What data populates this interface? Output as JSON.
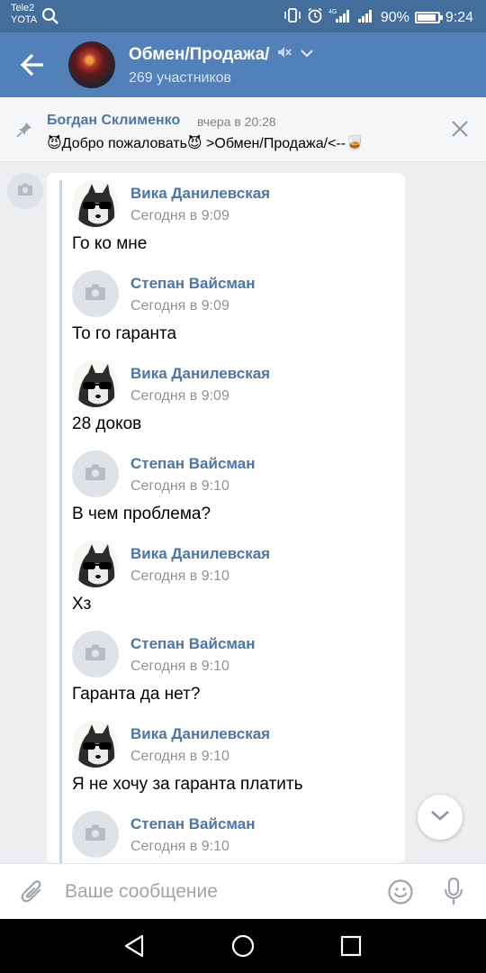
{
  "status_bar": {
    "carrier_1": "Tele2",
    "carrier_2": "YOTA",
    "network_label": "4G",
    "battery_text": "90%",
    "battery_level": 0.9,
    "time": "9:24"
  },
  "header": {
    "title": "Обмен/Продажа/",
    "subtitle": "269 участников"
  },
  "pinned": {
    "author": "Богдан Склименко",
    "time": "вчера в 20:28",
    "text": "😈Добро пожаловать😈 >Обмен/Продажа/<--🥃"
  },
  "messages": [
    {
      "author": "Вика Данилевская",
      "time": "Сегодня в 9:09",
      "text": "Го ко мне",
      "avatar": "dog-avatar"
    },
    {
      "author": "Степан Вайсман",
      "time": "Сегодня в 9:09",
      "text": "То го гаранта",
      "avatar": "camera-placeholder"
    },
    {
      "author": "Вика Данилевская",
      "time": "Сегодня в 9:09",
      "text": "28 доков",
      "avatar": "dog-avatar"
    },
    {
      "author": "Степан Вайсман",
      "time": "Сегодня в 9:10",
      "text": "В чем проблема?",
      "avatar": "camera-placeholder"
    },
    {
      "author": "Вика Данилевская",
      "time": "Сегодня в 9:10",
      "text": "Хз",
      "avatar": "dog-avatar"
    },
    {
      "author": "Степан Вайсман",
      "time": "Сегодня в 9:10",
      "text": "Гаранта да нет?",
      "avatar": "camera-placeholder"
    },
    {
      "author": "Вика Данилевская",
      "time": "Сегодня в 9:10",
      "text": "Я не хочу за гаранта платить",
      "avatar": "dog-avatar"
    },
    {
      "author": "Степан Вайсман",
      "time": "Сегодня в 9:10",
      "text": "",
      "avatar": "camera-placeholder"
    }
  ],
  "composer": {
    "placeholder": "Ваше сообщение"
  },
  "colors": {
    "header": "#5181b8",
    "status_bar": "#436d9a",
    "link_blue": "#4a76a8"
  }
}
